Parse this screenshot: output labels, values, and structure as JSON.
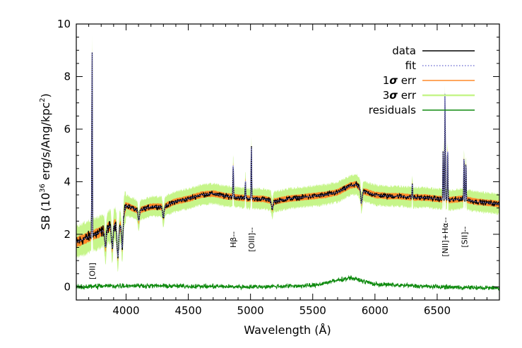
{
  "colors": {
    "data": "#000000",
    "fit": "#7b7bd6",
    "err1": "#ff8a2a",
    "err3": "#c6f58a",
    "residuals": "#0e8a0e",
    "axis": "#000000"
  },
  "chart_data": {
    "type": "line",
    "xlabel": "Wavelength (Å)",
    "ylabel_parts": {
      "pre": "SB (10",
      "sup": "36",
      "mid": " erg/s/Ang/kpc",
      "sup2": "2",
      "post": ")"
    },
    "xlim": [
      3600,
      7000
    ],
    "ylim": [
      -0.5,
      10
    ],
    "x_ticks": [
      4000,
      4500,
      5000,
      5500,
      6000,
      6500
    ],
    "x_tick_labels": [
      "4000",
      "4500",
      "5000",
      "5500",
      "6000",
      "6500"
    ],
    "y_ticks": [
      0,
      2,
      4,
      6,
      8,
      10
    ],
    "y_tick_labels": [
      "0",
      "2",
      "4",
      "6",
      "8",
      "10"
    ],
    "legend": {
      "position": "top-right",
      "entries": [
        {
          "label_parts": [
            "data"
          ],
          "series": "data",
          "style": "solid"
        },
        {
          "label_parts": [
            "fit"
          ],
          "series": "fit",
          "style": "dotted"
        },
        {
          "label_parts": [
            "1",
            "σ",
            " err"
          ],
          "series": "err1",
          "style": "solid"
        },
        {
          "label_parts": [
            "3",
            "σ",
            " err"
          ],
          "series": "err3",
          "style": "solid"
        },
        {
          "label_parts": [
            "residuals"
          ],
          "series": "residuals",
          "style": "solid"
        }
      ]
    },
    "annotations": [
      {
        "label": "[OII]",
        "x": 3727,
        "y": 0.6
      },
      {
        "label": "Hβ--",
        "x": 4861,
        "y": 1.8
      },
      {
        "label": "[OIII]--",
        "x": 5007,
        "y": 1.8
      },
      {
        "label": "[NII]+Hα--",
        "x": 6563,
        "y": 1.9
      },
      {
        "label": "[SII]--",
        "x": 6720,
        "y": 1.9
      }
    ],
    "continuum": [
      [
        3600,
        1.7
      ],
      [
        3700,
        1.9
      ],
      [
        3800,
        2.1
      ],
      [
        3900,
        2.4
      ],
      [
        3950,
        2.3
      ],
      [
        4000,
        3.1
      ],
      [
        4100,
        2.9
      ],
      [
        4200,
        3.05
      ],
      [
        4300,
        3.05
      ],
      [
        4400,
        3.25
      ],
      [
        4500,
        3.35
      ],
      [
        4600,
        3.5
      ],
      [
        4700,
        3.55
      ],
      [
        4800,
        3.45
      ],
      [
        4900,
        3.4
      ],
      [
        5000,
        3.35
      ],
      [
        5100,
        3.35
      ],
      [
        5200,
        3.25
      ],
      [
        5300,
        3.35
      ],
      [
        5400,
        3.4
      ],
      [
        5500,
        3.45
      ],
      [
        5600,
        3.5
      ],
      [
        5700,
        3.6
      ],
      [
        5800,
        3.85
      ],
      [
        5850,
        3.9
      ],
      [
        5900,
        3.65
      ],
      [
        6000,
        3.5
      ],
      [
        6100,
        3.45
      ],
      [
        6200,
        3.45
      ],
      [
        6300,
        3.4
      ],
      [
        6400,
        3.4
      ],
      [
        6500,
        3.35
      ],
      [
        6600,
        3.3
      ],
      [
        6700,
        3.35
      ],
      [
        6800,
        3.25
      ],
      [
        6900,
        3.2
      ],
      [
        7000,
        3.15
      ]
    ],
    "emission_lines": [
      {
        "x": 3727,
        "peak": 9.1
      },
      {
        "x": 4861,
        "peak": 4.75
      },
      {
        "x": 4959,
        "peak": 4.1
      },
      {
        "x": 5007,
        "peak": 5.35
      },
      {
        "x": 6300,
        "peak": 3.9
      },
      {
        "x": 6548,
        "peak": 5.2
      },
      {
        "x": 6563,
        "peak": 7.45
      },
      {
        "x": 6584,
        "peak": 5.35
      },
      {
        "x": 6716,
        "peak": 5.0
      },
      {
        "x": 6731,
        "peak": 4.75
      }
    ],
    "absorption_lines": [
      {
        "x": 3835,
        "depth": 0.7
      },
      {
        "x": 3889,
        "depth": 0.9
      },
      {
        "x": 3934,
        "depth": 1.2
      },
      {
        "x": 3969,
        "depth": 1.1
      },
      {
        "x": 4102,
        "depth": 0.4
      },
      {
        "x": 4300,
        "depth": 0.4
      },
      {
        "x": 5175,
        "depth": 0.3
      },
      {
        "x": 5892,
        "depth": 0.5
      }
    ],
    "err1_halfwidth": 0.12,
    "err3_halfwidth": 0.38,
    "residual_baseline": [
      [
        3600,
        0.0
      ],
      [
        4000,
        0.05
      ],
      [
        5000,
        0.0
      ],
      [
        5500,
        0.05
      ],
      [
        5800,
        0.35
      ],
      [
        6000,
        0.1
      ],
      [
        6500,
        0.0
      ],
      [
        7000,
        -0.05
      ]
    ],
    "residual_noise": 0.12
  }
}
